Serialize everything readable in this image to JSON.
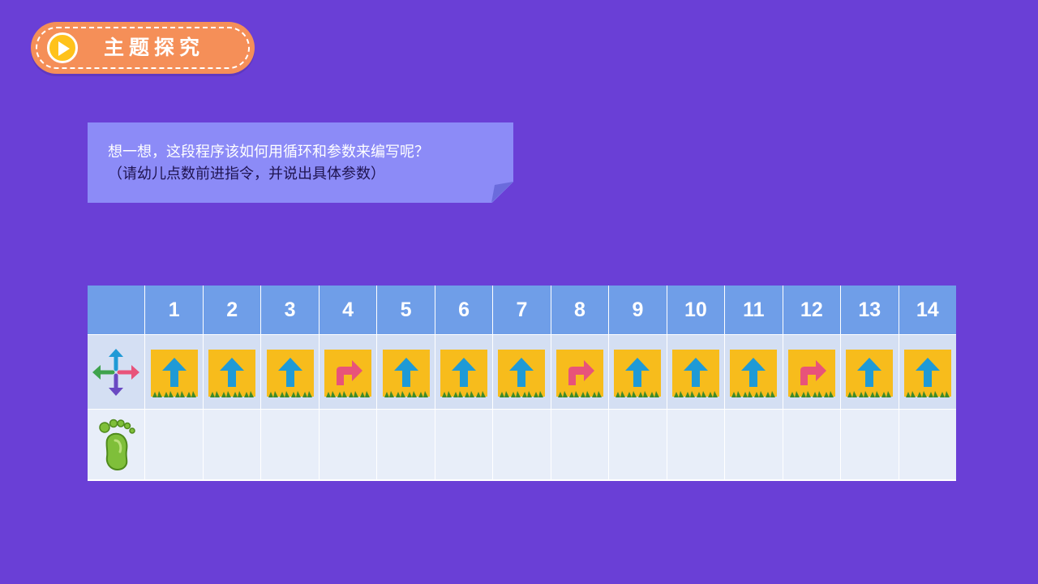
{
  "badge": {
    "title": "主题探究",
    "icon": "play-icon",
    "color": "#f58f58"
  },
  "prompt": {
    "line1": "想一想，这段程序该如何用循环和参数来编写呢？",
    "line2": "（请幼儿点数前进指令，并说出具体参数）"
  },
  "table": {
    "row_icons": [
      "four-direction-arrows-icon",
      "footprint-icon"
    ],
    "steps": [
      {
        "number": "1",
        "command": "forward"
      },
      {
        "number": "2",
        "command": "forward"
      },
      {
        "number": "3",
        "command": "forward"
      },
      {
        "number": "4",
        "command": "turn-right"
      },
      {
        "number": "5",
        "command": "forward"
      },
      {
        "number": "6",
        "command": "forward"
      },
      {
        "number": "7",
        "command": "forward"
      },
      {
        "number": "8",
        "command": "turn-right"
      },
      {
        "number": "9",
        "command": "forward"
      },
      {
        "number": "10",
        "command": "forward"
      },
      {
        "number": "11",
        "command": "forward"
      },
      {
        "number": "12",
        "command": "turn-right"
      },
      {
        "number": "13",
        "command": "forward"
      },
      {
        "number": "14",
        "command": "forward"
      }
    ]
  },
  "colors": {
    "background": "#6a3fd6",
    "header": "#6f9ee8",
    "card": "#f7bc1c",
    "forward_arrow": "#1f9ad6",
    "turn_arrow": "#e8537a"
  }
}
